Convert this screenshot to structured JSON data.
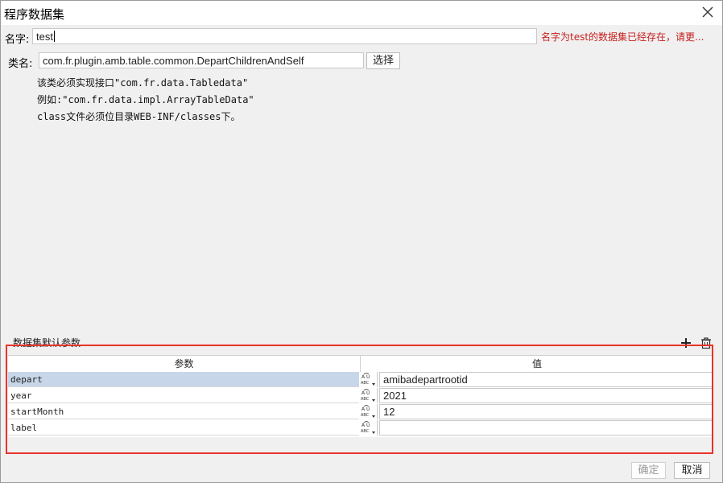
{
  "dialog": {
    "title": "程序数据集",
    "name_label": "名字:",
    "name_value": "test",
    "warning": "名字为test的数据集已经存在，请更...",
    "class_label": "类名:",
    "class_value": "com.fr.plugin.amb.table.common.DepartChildrenAndSelf",
    "choose_button": "选择",
    "notes": [
      "该类必须实现接口\"com.fr.data.Tabledata\"",
      "例如:\"com.fr.data.impl.ArrayTableData\"",
      "class文件必须位目录WEB-INF/classes下。"
    ]
  },
  "params": {
    "section_label": "数据集默认参数",
    "columns": {
      "param": "参数",
      "value": "值"
    },
    "rows": [
      {
        "name": "depart",
        "value": "amibadepartrootid"
      },
      {
        "name": "year",
        "value": "2021"
      },
      {
        "name": "startMonth",
        "value": "12"
      },
      {
        "name": "label",
        "value": ""
      }
    ]
  },
  "footer": {
    "ok_button": "确定",
    "cancel_button": "取消"
  },
  "icons": {
    "close": "close-icon",
    "add": "plus-icon",
    "delete": "trash-icon",
    "type": "string-type-icon"
  },
  "colors": {
    "warning": "#c81e1e",
    "highlight": "#e8332a",
    "selected_row": "#c7d7e9"
  }
}
